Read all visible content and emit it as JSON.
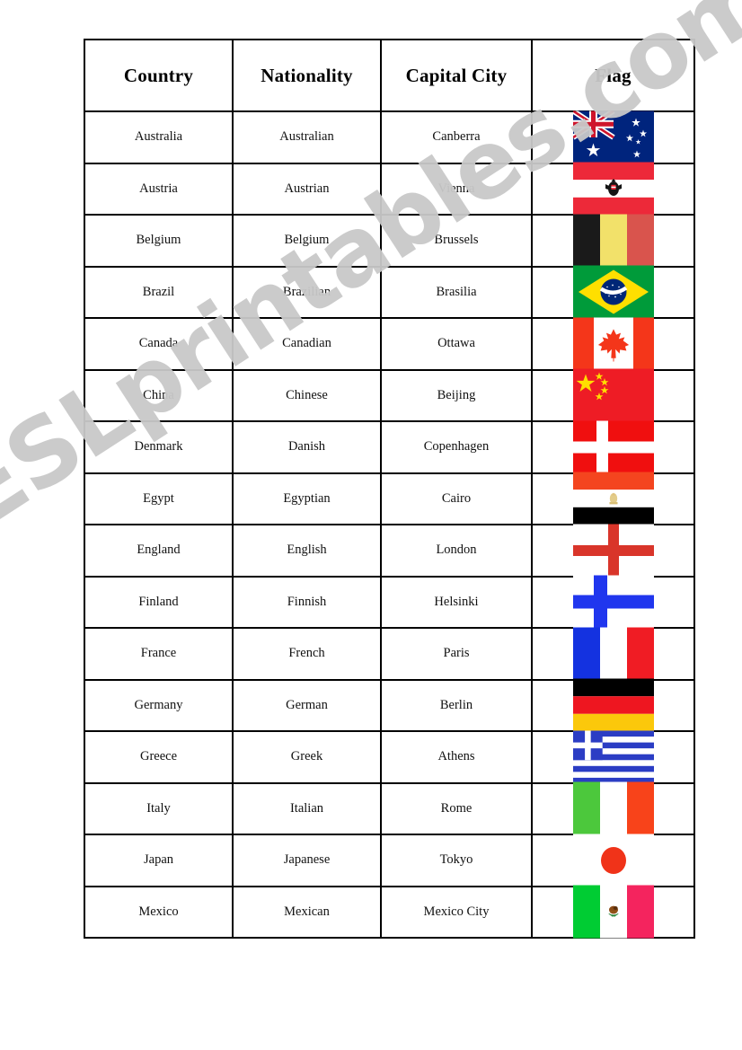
{
  "document": {
    "watermark": "ESLprintables.com",
    "page_background": "#ffffff",
    "border_color": "#000000"
  },
  "table": {
    "headers": [
      "Country",
      "Nationality",
      "Capital City",
      "Flag"
    ],
    "rows": [
      {
        "country": "Australia",
        "nationality": "Australian",
        "capital": "Canberra",
        "flag": "australia-flag"
      },
      {
        "country": "Austria",
        "nationality": "Austrian",
        "capital": "Vienna",
        "flag": "austria-flag"
      },
      {
        "country": "Belgium",
        "nationality": "Belgium",
        "capital": "Brussels",
        "flag": "belgium-flag"
      },
      {
        "country": "Brazil",
        "nationality": "Brazilian",
        "capital": "Brasilia",
        "flag": "brazil-flag"
      },
      {
        "country": "Canada",
        "nationality": "Canadian",
        "capital": "Ottawa",
        "flag": "canada-flag"
      },
      {
        "country": "China",
        "nationality": "Chinese",
        "capital": "Beijing",
        "flag": "china-flag"
      },
      {
        "country": "Denmark",
        "nationality": "Danish",
        "capital": "Copenhagen",
        "flag": "denmark-flag"
      },
      {
        "country": "Egypt",
        "nationality": "Egyptian",
        "capital": "Cairo",
        "flag": "egypt-flag"
      },
      {
        "country": "England",
        "nationality": "English",
        "capital": "London",
        "flag": "england-flag"
      },
      {
        "country": "Finland",
        "nationality": "Finnish",
        "capital": "Helsinki",
        "flag": "finland-flag"
      },
      {
        "country": "France",
        "nationality": "French",
        "capital": "Paris",
        "flag": "france-flag"
      },
      {
        "country": "Germany",
        "nationality": "German",
        "capital": "Berlin",
        "flag": "germany-flag"
      },
      {
        "country": "Greece",
        "nationality": "Greek",
        "capital": "Athens",
        "flag": "greece-flag"
      },
      {
        "country": "Italy",
        "nationality": "Italian",
        "capital": "Rome",
        "flag": "italy-flag"
      },
      {
        "country": "Japan",
        "nationality": "Japanese",
        "capital": "Tokyo",
        "flag": "japan-flag"
      },
      {
        "country": "Mexico",
        "nationality": "Mexican",
        "capital": "Mexico City",
        "flag": "mexico-flag"
      }
    ]
  },
  "flag_colors": {
    "australia_navy": "#00247d",
    "australia_red": "#cf142b",
    "austria_red": "#ed2939",
    "belgium_black": "#1a1a1a",
    "belgium_yellow": "#f2e16a",
    "belgium_red": "#d9544d",
    "brazil_green": "#009b3a",
    "brazil_yellow": "#ffdf00",
    "brazil_blue": "#002776",
    "canada_red": "#f4361a",
    "china_red": "#ee1c25",
    "china_yellow": "#ffde00",
    "denmark_red": "#f00f0f",
    "egypt_red": "#f4451f",
    "egypt_black": "#000000",
    "egypt_gold": "#e3cc8a",
    "england_red": "#d9352a",
    "finland_blue": "#2036ee",
    "france_blue": "#1432e0",
    "france_red": "#f01c24",
    "germany_black": "#000000",
    "germany_red": "#ee1620",
    "germany_gold": "#fbc80b",
    "greece_blue": "#2b3dc4",
    "italy_green": "#4cc83c",
    "italy_red": "#f8431a",
    "japan_red": "#f03319",
    "mexico_green": "#00cc33",
    "mexico_red": "#f4245e"
  }
}
